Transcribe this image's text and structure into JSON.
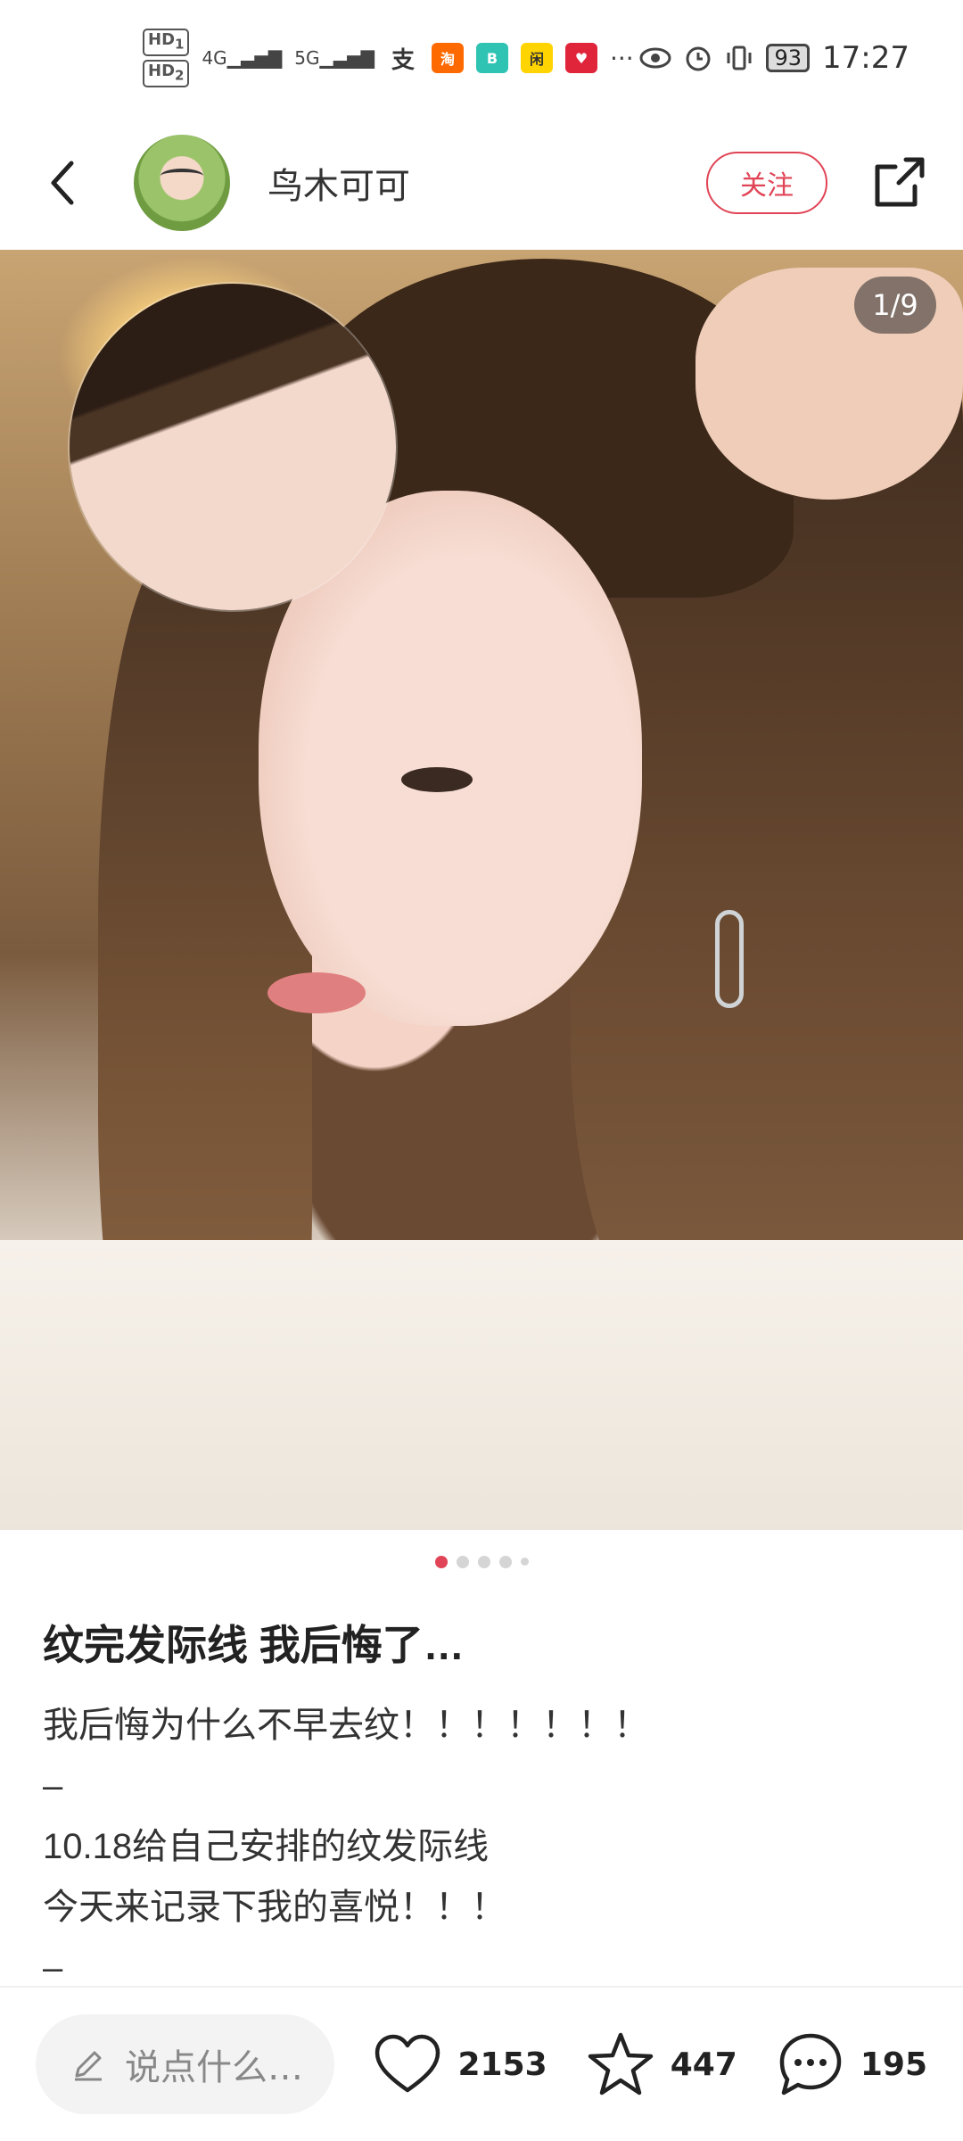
{
  "status_bar": {
    "hd1": "HD",
    "hd1_sub": "1",
    "hd2": "HD",
    "hd2_sub": "2",
    "net1": "4G",
    "net2": "5G",
    "more": "···",
    "battery": "93",
    "time": "17:27"
  },
  "header": {
    "author_name": "鸟木可可",
    "follow_label": "关注"
  },
  "photo": {
    "counter": "1/9"
  },
  "pagination": {
    "active_index": 0,
    "count": 5
  },
  "post": {
    "title": "纹完发际线 我后悔了…",
    "lines": [
      "我后悔为什么不早去纹！！！！！！！",
      "–",
      "10.18给自己安排的纹发际线",
      "今天来记录下我的喜悦！！！",
      "–"
    ]
  },
  "bottom_bar": {
    "comment_placeholder": "说点什么…",
    "likes": "2153",
    "collects": "447",
    "comments": "195"
  },
  "colors": {
    "accent": "#e04456"
  }
}
